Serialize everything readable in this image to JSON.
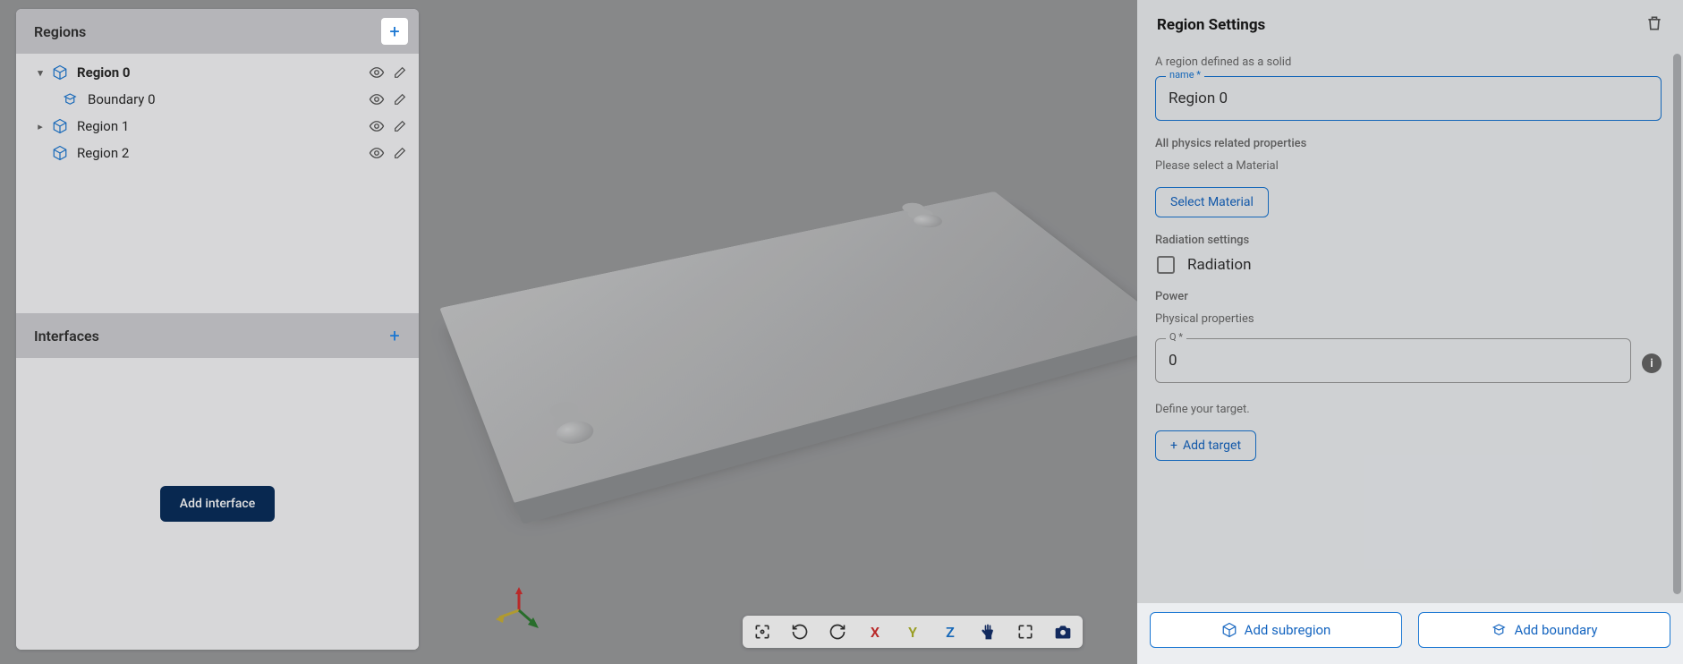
{
  "left": {
    "regions_title": "Regions",
    "interfaces_title": "Interfaces",
    "add_interface": "Add interface",
    "tree": [
      {
        "label": "Region 0",
        "expanded": true,
        "selected": true,
        "children": [
          {
            "label": "Boundary 0",
            "type": "boundary"
          }
        ]
      },
      {
        "label": "Region 1",
        "expanded": false,
        "selected": false,
        "children": []
      },
      {
        "label": "Region 2",
        "expanded": null,
        "selected": false,
        "children": []
      }
    ]
  },
  "toolbar3d": {
    "x": "X",
    "y": "Y",
    "z": "Z"
  },
  "right": {
    "title": "Region Settings",
    "desc": "A region defined as a solid",
    "name_label": "name *",
    "name_value": "Region 0",
    "physics_heading": "All physics related properties",
    "material_prompt": "Please select a Material",
    "select_material": "Select Material",
    "radiation_heading": "Radiation settings",
    "radiation_label": "Radiation",
    "power_heading": "Power",
    "physical_props": "Physical properties",
    "q_label": "Q *",
    "q_value": "0",
    "target_heading": "Define your target.",
    "add_target": "Add target",
    "add_subregion": "Add subregion",
    "add_boundary": "Add boundary"
  }
}
